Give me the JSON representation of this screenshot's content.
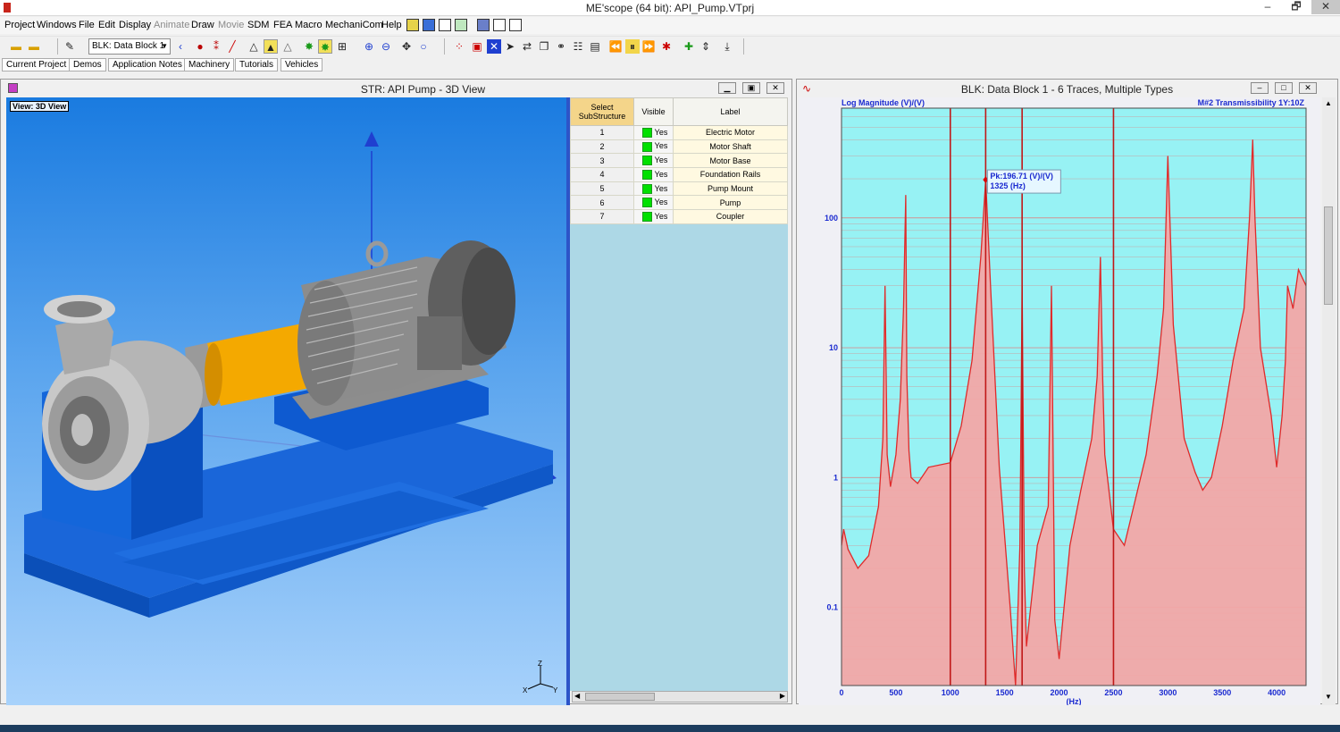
{
  "app": {
    "title": "ME'scope (64 bit): API_Pump.VTprj",
    "window_buttons": [
      "–",
      "🗗",
      "✕"
    ]
  },
  "menu": [
    "Project",
    "Windows",
    "File",
    "Edit",
    "Display",
    "Animate",
    "Draw",
    "Movie",
    "SDM",
    "FEA",
    "Macro",
    "MechaniCom",
    "Help"
  ],
  "menu_disabled": [
    "Animate",
    "Movie"
  ],
  "toolbar": {
    "block_selector": "BLK: Data Block 1"
  },
  "links": [
    "Current Project",
    "Demos",
    "Application Notes",
    "Machinery",
    "Tutorials",
    "Vehicles"
  ],
  "structure_window": {
    "title": "STR: API Pump - 3D View",
    "view_label": "View: 3D View",
    "axes_labels": [
      "Z",
      "X",
      "Y"
    ],
    "table": {
      "headers": [
        "Select SubStructure",
        "Visible",
        "Label"
      ],
      "rows": [
        {
          "num": "1",
          "visible": "Yes",
          "label": "Electric Motor"
        },
        {
          "num": "2",
          "visible": "Yes",
          "label": "Motor Shaft"
        },
        {
          "num": "3",
          "visible": "Yes",
          "label": "Motor Base"
        },
        {
          "num": "4",
          "visible": "Yes",
          "label": "Foundation Rails"
        },
        {
          "num": "5",
          "visible": "Yes",
          "label": "Pump Mount"
        },
        {
          "num": "6",
          "visible": "Yes",
          "label": "Pump"
        },
        {
          "num": "7",
          "visible": "Yes",
          "label": "Coupler"
        }
      ]
    },
    "colors": {
      "splitter": "#2d54c8",
      "visible_on": "#00e000"
    }
  },
  "data_window": {
    "title": "BLK: Data Block 1 - 6 Traces, Multiple Types",
    "window_buttons": [
      "–",
      "□",
      "✕"
    ]
  },
  "chart_data": {
    "type": "area",
    "title": "",
    "ylabel": "Log Magnitude (V)/(V)",
    "trace_label": "M#2 Transmissibility 1Y:10Z",
    "xlabel": "(Hz)",
    "xlim": [
      0,
      4270
    ],
    "ylim": [
      0.025,
      700
    ],
    "yscale": "log",
    "x_ticks": [
      0,
      500,
      1000,
      1500,
      2000,
      2500,
      3000,
      3500,
      4000
    ],
    "x_tick_labels": [
      "0",
      "500",
      "1000",
      "1500",
      "2000",
      "2500",
      "3000",
      "3500",
      "4000"
    ],
    "y_ticks": [
      0.1,
      1,
      10,
      100
    ],
    "y_tick_labels": [
      "0.1",
      "1",
      "10",
      "100"
    ],
    "grid": true,
    "cursor_lines_hz": [
      1000,
      1325,
      1660,
      2500
    ],
    "peak_annotation": {
      "line1": "Pk:196.71 (V)/(V)",
      "line2": "1325 (Hz)",
      "x": 1325,
      "y": 196.71
    },
    "colors": {
      "plot_bg": "#97f2f4",
      "trace": "#e02a2a",
      "fill": "#f2a7a7",
      "grid": "#e07a7a"
    },
    "x": [
      0,
      20,
      60,
      150,
      250,
      340,
      380,
      400,
      420,
      450,
      500,
      540,
      570,
      590,
      600,
      620,
      640,
      700,
      800,
      1000,
      1100,
      1200,
      1280,
      1325,
      1370,
      1450,
      1550,
      1600,
      1640,
      1660,
      1680,
      1700,
      1800,
      1900,
      1930,
      1960,
      2000,
      2100,
      2200,
      2300,
      2350,
      2380,
      2400,
      2420,
      2500,
      2600,
      2800,
      2900,
      2960,
      3000,
      3050,
      3150,
      3250,
      3320,
      3400,
      3500,
      3600,
      3700,
      3750,
      3780,
      3800,
      3850,
      3950,
      4000,
      4050,
      4080,
      4100,
      4150,
      4200,
      4270
    ],
    "y": [
      0.3,
      0.4,
      0.28,
      0.2,
      0.25,
      0.6,
      2,
      30,
      1.5,
      0.85,
      1.5,
      4,
      20,
      150,
      6,
      1.6,
      1,
      0.9,
      1.2,
      1.3,
      2.5,
      8,
      50,
      196.71,
      30,
      1.2,
      0.1,
      0.02,
      0.3,
      30,
      0.2,
      0.05,
      0.3,
      0.6,
      30,
      0.08,
      0.04,
      0.3,
      0.8,
      2,
      6,
      50,
      6,
      1.5,
      0.4,
      0.3,
      1.5,
      6,
      20,
      300,
      15,
      2,
      1.1,
      0.8,
      1,
      2.5,
      8,
      20,
      100,
      400,
      100,
      10,
      3,
      1.2,
      3,
      8,
      30,
      20,
      40,
      30
    ]
  }
}
